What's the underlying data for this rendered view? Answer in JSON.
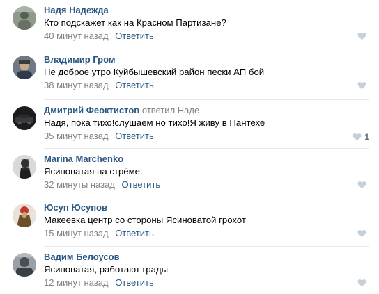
{
  "comments": [
    {
      "author": "Надя Надежда",
      "reply_note": "",
      "reply_target": "",
      "text": "Кто подскажет как на Красном Партизане?",
      "time": "40 минут назад",
      "reply_label": "Ответить",
      "like_icon": "heart-icon",
      "like_count": ""
    },
    {
      "author": "Владимир Гром",
      "reply_note": "",
      "reply_target": "",
      "text": "Не доброе утро Куйбышевский район пески АП бой",
      "time": "38 минут назад",
      "reply_label": "Ответить",
      "like_icon": "heart-icon",
      "like_count": ""
    },
    {
      "author": "Дмитрий Феоктистов",
      "reply_note": "ответил",
      "reply_target": "Наде",
      "text": "Надя, пока тихо!слушаем но тихо!Я живу в Пантехе",
      "time": "35 минут назад",
      "reply_label": "Ответить",
      "like_icon": "heart-icon",
      "like_count": "1"
    },
    {
      "author": "Marina Marchenko",
      "reply_note": "",
      "reply_target": "",
      "text": "Ясиноватая на стрёме.",
      "time": "32 минуты назад",
      "reply_label": "Ответить",
      "like_icon": "heart-icon",
      "like_count": ""
    },
    {
      "author": "Юсуп Юсупов",
      "reply_note": "",
      "reply_target": "",
      "text": "Макеевка центр со стороны Ясиноватой грохот",
      "time": "15 минут назад",
      "reply_label": "Ответить",
      "like_icon": "heart-icon",
      "like_count": ""
    },
    {
      "author": "Вадим Белоусов",
      "reply_note": "",
      "reply_target": "",
      "text": "Ясиноватая, работают грады",
      "time": "12 минут назад",
      "reply_label": "Ответить",
      "like_icon": "heart-icon",
      "like_count": ""
    }
  ],
  "colors": {
    "link": "#2a5885",
    "muted": "#828282",
    "like": "#c5d0db",
    "divider": "#e7e8ec"
  }
}
